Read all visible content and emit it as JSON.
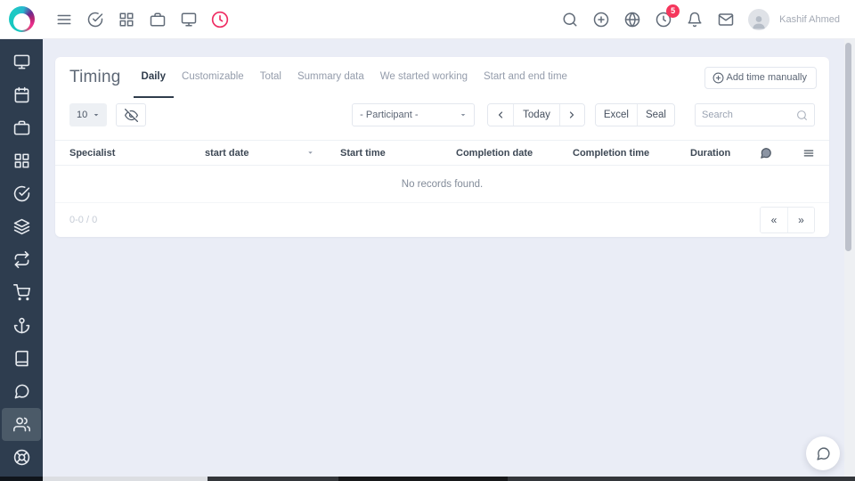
{
  "topbar": {
    "user_name": "Kashif Ahmed",
    "notification_count": "5",
    "icons_left": [
      "menu-icon",
      "check-circle-icon",
      "apps-grid-icon",
      "briefcase-icon",
      "monitor-icon",
      "timer-icon"
    ],
    "icons_right": [
      "search-icon",
      "plus-circle-icon",
      "globe-icon",
      "history-clock-icon",
      "bell-icon",
      "mail-icon"
    ]
  },
  "sidebar": {
    "items": [
      "monitor",
      "calendar",
      "briefcase",
      "apps-grid",
      "check-circle",
      "layers",
      "repeat",
      "cart",
      "anchor",
      "book",
      "chat",
      "users",
      "life-buoy"
    ],
    "active_item": "users"
  },
  "page": {
    "title": "Timing",
    "tabs": [
      {
        "label": "Daily",
        "active": true
      },
      {
        "label": "Customizable",
        "active": false
      },
      {
        "label": "Total",
        "active": false
      },
      {
        "label": "Summary data",
        "active": false
      },
      {
        "label": "We started working",
        "active": false
      },
      {
        "label": "Start and end time",
        "active": false
      }
    ],
    "add_time_button": "Add time manually"
  },
  "filters": {
    "rows_per_page": "10",
    "participant": "- Participant -",
    "today": "Today",
    "export": [
      "Excel",
      "Seal"
    ],
    "search_placeholder": "Search",
    "search_value": ""
  },
  "table": {
    "columns": [
      "Specialist",
      "start date",
      "Start time",
      "Completion date",
      "Completion time",
      "Duration"
    ],
    "empty": "No records found.",
    "range": "0-0 / 0",
    "pager": {
      "first": "«",
      "last": "»"
    }
  },
  "colors": {
    "accent": "#ef2d63",
    "badge": "#f5365c",
    "sidebar": "#2e3d4f",
    "background": "#eaedf6",
    "active_tab": "#2f3c4c"
  }
}
